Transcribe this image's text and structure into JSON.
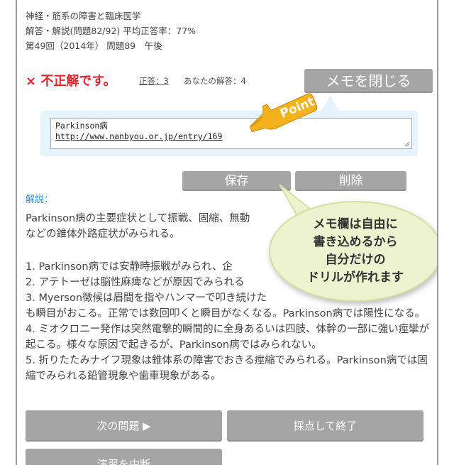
{
  "header": {
    "category": "神経・筋系の障害と臨床医学",
    "progress": "解答・解説(問題82/92) 平均正答率：77%",
    "exam": "第49回（2014年） 問題89　午後"
  },
  "result": {
    "mark": "×",
    "verdict": "不正解です。",
    "correct_label": "正答：3",
    "your_answer_label": "あなたの解答：4"
  },
  "memo": {
    "close_button": "メモを閉じる",
    "line1": "Parkinson病",
    "line2": "http://www.nanbyou.or.jp/entry/169",
    "save_button": "保存",
    "delete_button": "削除",
    "point_label": "Point"
  },
  "explanation": {
    "label": "解説：",
    "intro_a": "Parkinson病の主要症状として振戦、固縮、無動",
    "intro_b": "などの錐体外路症状がみられる。",
    "items": [
      "1.  Parkinson病では安静時振戦がみられ、企",
      "2.  アテトーゼは脳性麻痺などが原因でみられる",
      "3.  Myerson徴候は眉間を指やハンマーで叩き続けた",
      "も瞬目がおこる。正常では数回叩くと瞬目がなくなる。Parkinson病では陽性になる。",
      "4.  ミオクロニー発作は突然電撃的瞬間的に全身あるいは四肢、体幹の一部に強い痙攣が起こる。様々な原因で起きるが、Parkinson病ではみられない。",
      "5.  折りたたみナイフ現象は錐体系の障害でおきる痙縮でみられる。Parkinson病では固縮でみられる鉛管現象や歯車現象がある。"
    ]
  },
  "callout": {
    "line1": "メモ欄は自由に",
    "line2": "書き込めるから",
    "line3": "自分だけの",
    "line4": "ドリルが作れます"
  },
  "nav": {
    "next_button": "次の問題 ▶",
    "finish_button": "採点して終了",
    "quit_button": "演習を中断"
  },
  "colors": {
    "accent_red": "#e8232d",
    "link_blue": "#2b8fce",
    "button_gray": "#a5a5a5",
    "memo_bg": "#e4f3fc",
    "point_orange": "#f3b21b",
    "bubble_bg": "#eef3cf"
  }
}
